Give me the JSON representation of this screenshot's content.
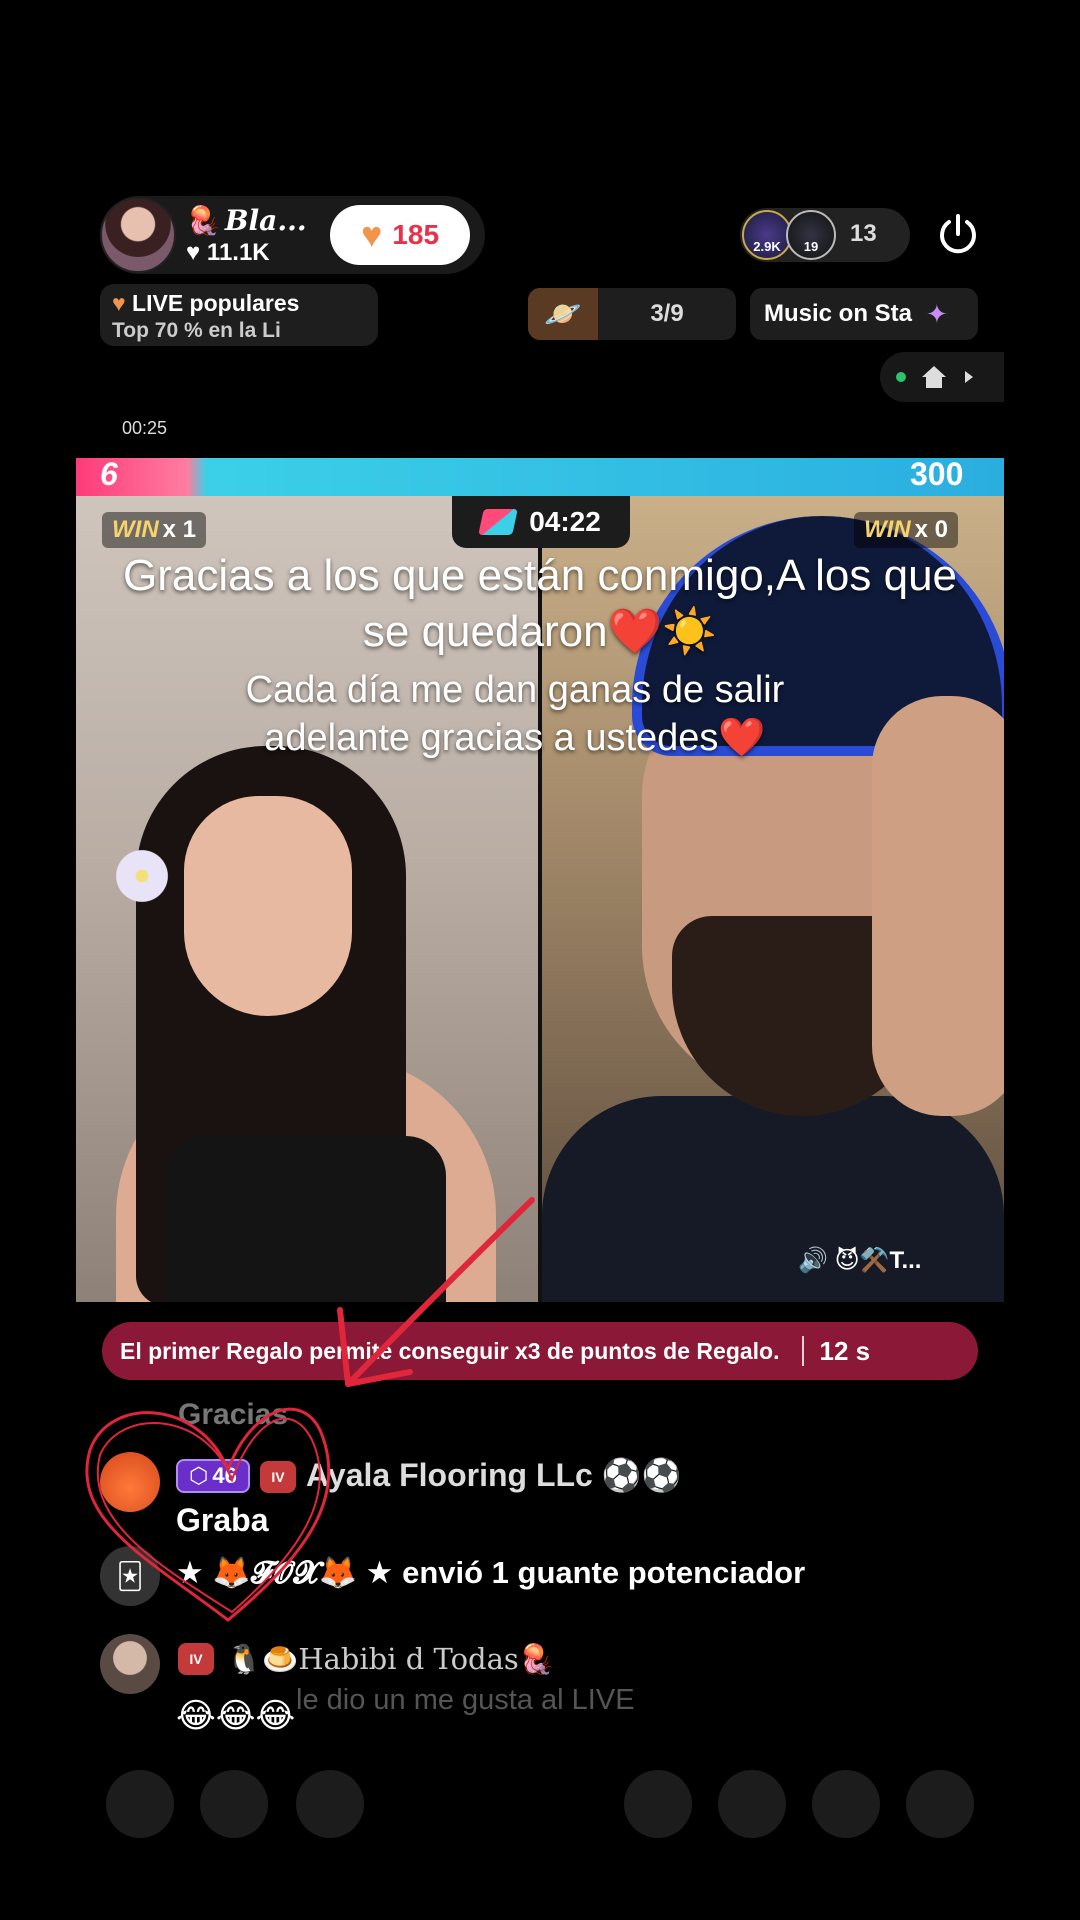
{
  "header": {
    "host_name": "Bla...",
    "host_likes": "11.1K",
    "heart_count": "185",
    "viewer_badges": [
      "2.9K",
      "19"
    ],
    "viewer_count": "13",
    "popular_label": "LIVE populares",
    "popular_sub": "Top 70 % en la Li",
    "rank_label": "3/9",
    "music_label": "Music on Sta"
  },
  "stream": {
    "elapsed": "00:25"
  },
  "battle": {
    "left_score": "6",
    "right_score": "300",
    "left_win_label": "WIN",
    "left_win_count": "x 1",
    "right_win_label": "WIN",
    "right_win_count": "x 0",
    "timer": "04:22",
    "guest_tag": "😈⚒️T..."
  },
  "overlay": {
    "title": "Gracias a los que están conmigo,A los que se quedaron❤️☀️",
    "subtitle": "Cada día me dan ganas de salir adelante gracias a ustedes❤️"
  },
  "promo": {
    "text": "El primer Regalo permite conseguir x3 de puntos de Regalo.",
    "seconds": "12 s"
  },
  "chat": {
    "faded_line": "Gracias",
    "msg1_level": "46",
    "msg1_iv": "IV",
    "msg1_user": "Ayala Flooring LLc ⚽⚽",
    "msg1_text": "Graba",
    "gift_text": "★ 🦊𝓕𝓞𝓧🦊 ★ envió 1 guante potenciador",
    "msg2_iv": "IV",
    "msg2_user": "🐧🍮Habibi d Todas🪼",
    "msg2_liked": "le dio un me gusta al LIVE",
    "msg2_text": "😂😂😂"
  },
  "colors": {
    "promo_bg": "#8a1836",
    "score_pink": "#ff3a7a",
    "score_cyan": "#2aaee0",
    "annotation_red": "#e0263a"
  },
  "icons": [
    "jellyfish-icon",
    "heart-icon",
    "power-icon",
    "planet-icon",
    "sparkle-icon",
    "home-icon",
    "chevron-right-icon",
    "battle-icon",
    "speaker-icon",
    "gift-card-icon"
  ]
}
